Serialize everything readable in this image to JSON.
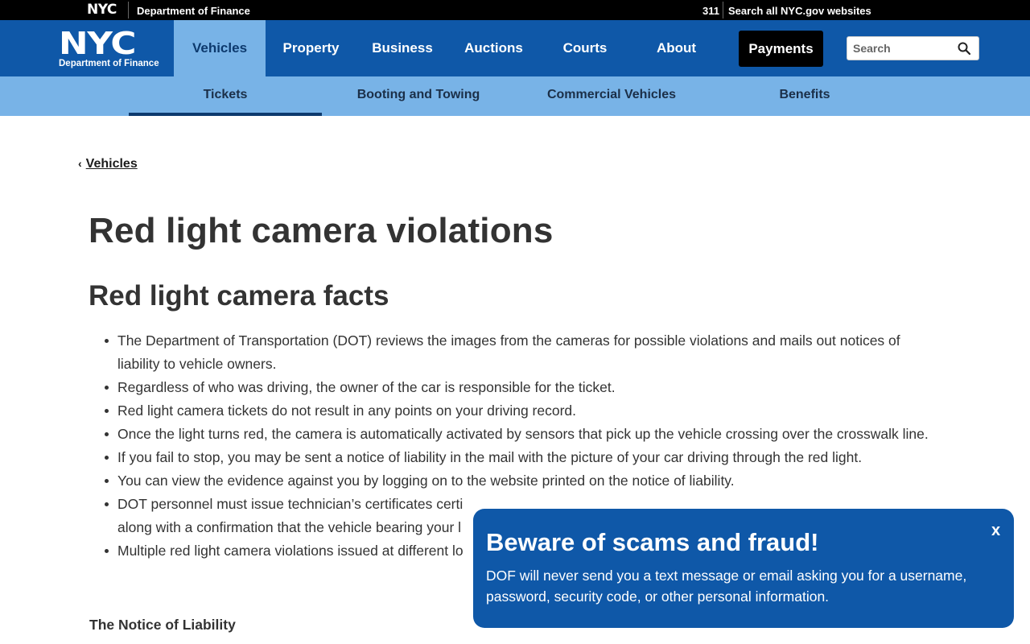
{
  "utility_bar": {
    "nyc_logo": "NYC",
    "department": "Department of Finance",
    "link_311": "311",
    "search_all": "Search all NYC.gov websites"
  },
  "header": {
    "logo_big": "NYC",
    "logo_sub": "Department of Finance",
    "nav": [
      {
        "label": "Vehicles",
        "active": true
      },
      {
        "label": "Property"
      },
      {
        "label": "Business"
      },
      {
        "label": "Auctions"
      },
      {
        "label": "Courts"
      },
      {
        "label": "About"
      }
    ],
    "payments_label": "Payments",
    "search_placeholder": "Search",
    "search_icon": "magnifier-icon"
  },
  "subnav": [
    {
      "label": "Tickets",
      "active": true
    },
    {
      "label": "Booting and Towing"
    },
    {
      "label": "Commercial Vehicles"
    },
    {
      "label": "Benefits"
    }
  ],
  "breadcrumb": {
    "chevron": "‹",
    "label": "Vehicles"
  },
  "main": {
    "title": "Red light camera violations",
    "section_title": "Red light camera facts",
    "facts": [
      "The Department of Transportation (DOT) reviews the images from the cameras for possible violations and mails out notices of liability to vehicle owners.",
      "Regardless of who was driving, the owner of the car is responsible for the ticket.",
      "Red light camera tickets do not result in any points on your driving record.",
      "Once the light turns red, the camera is automatically activated by sensors that pick up the vehicle crossing over the crosswalk line.",
      "If you fail to stop, you may be sent a notice of liability in the mail with the picture of your car driving through the red light.",
      "You can view the evidence against you by logging on to the website printed on the notice of liability.",
      "DOT personnel must issue technician’s certificates certi",
      "along with a confirmation that the vehicle bearing your l",
      "Multiple red light camera violations issued at different lo"
    ],
    "notice_heading": "The Notice of Liability"
  },
  "popup": {
    "title": "Beware of scams and fraud!",
    "body": "DOF will never send you a text message or email asking you for a username, password, security code, or other personal information.",
    "close_label": "x"
  },
  "colors": {
    "nav_blue": "#0f58a8",
    "subnav_blue": "#78b3e7",
    "active_text": "#0d3a6e"
  }
}
